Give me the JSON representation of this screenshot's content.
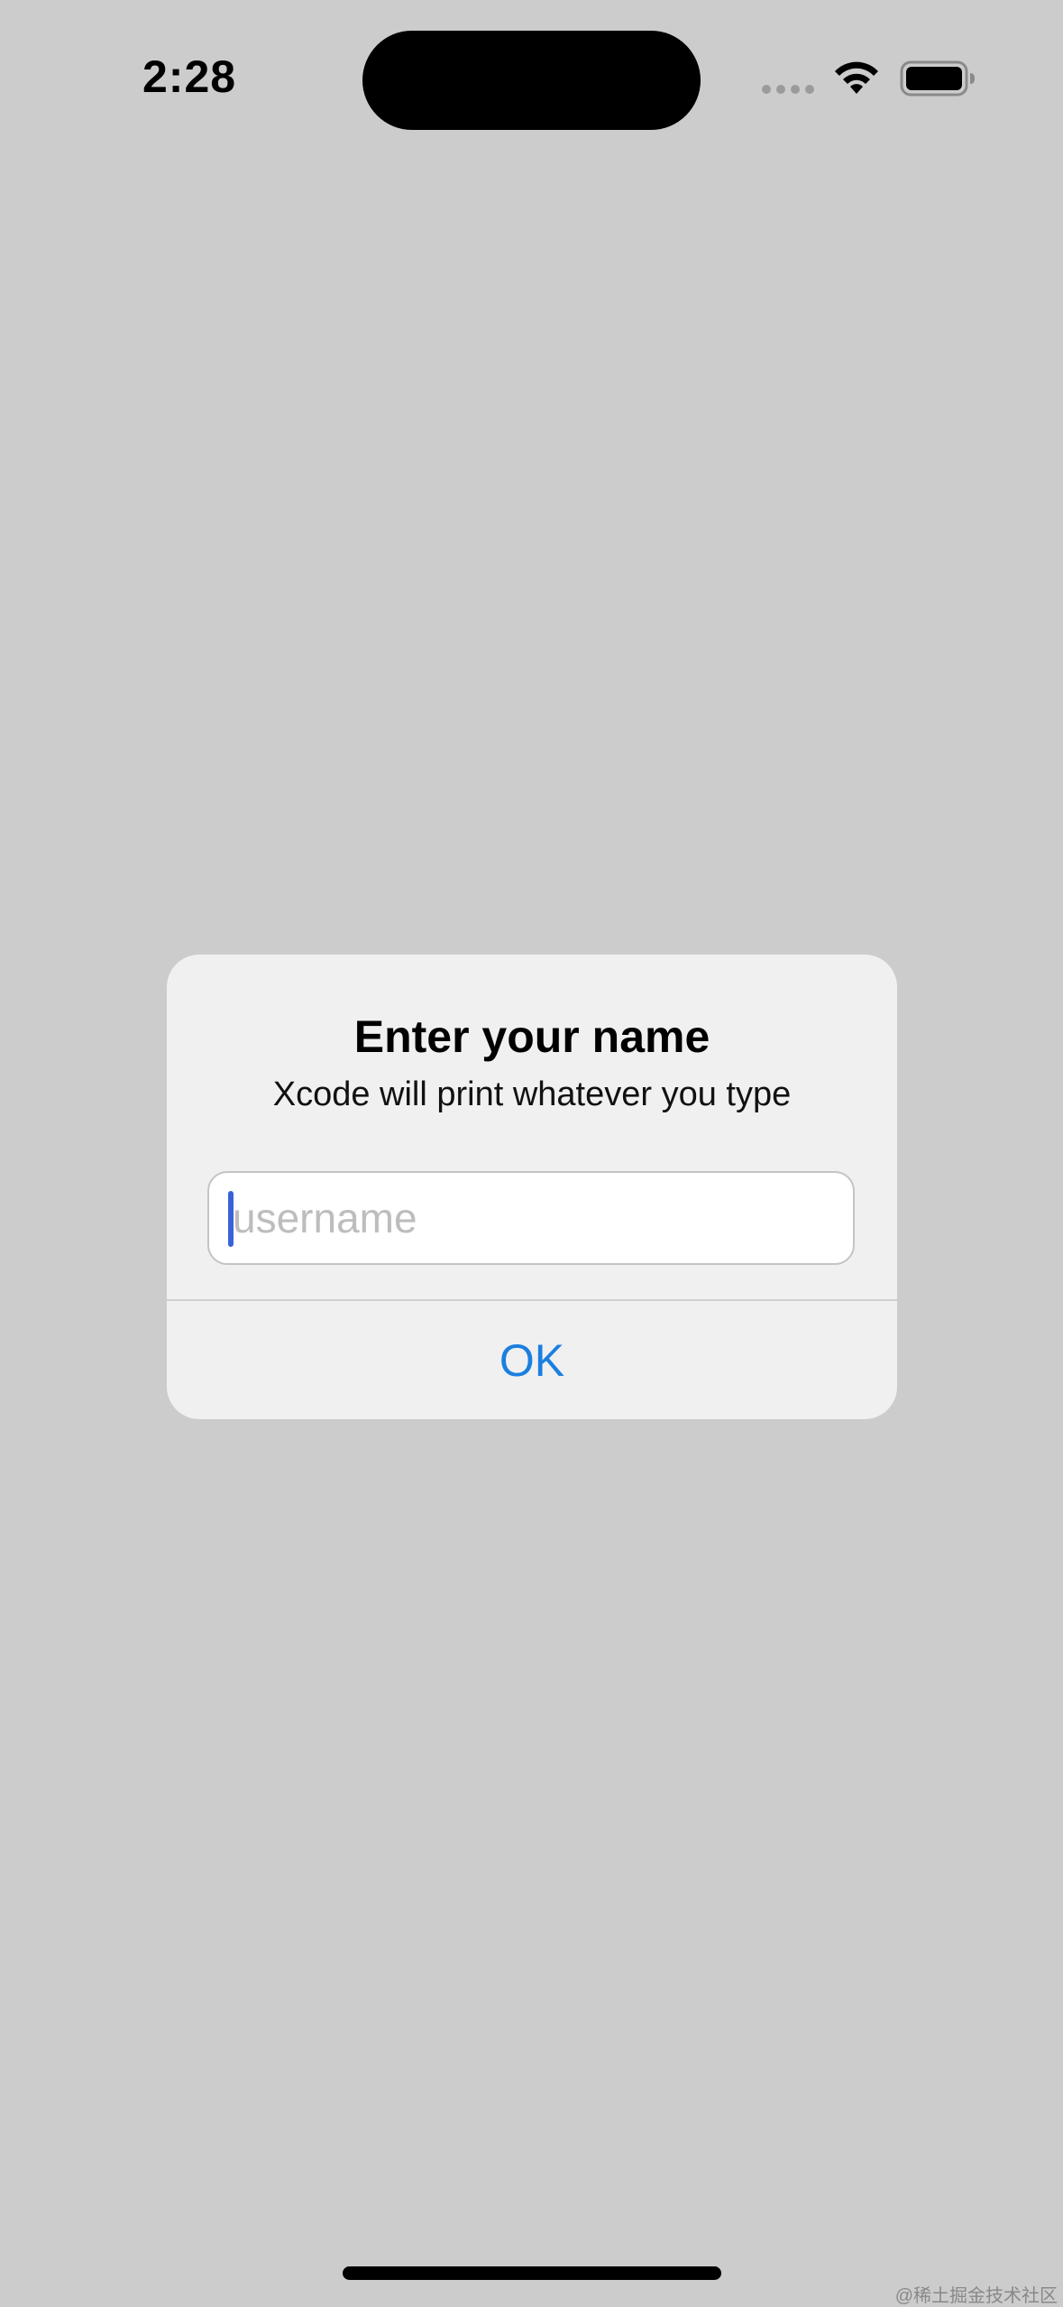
{
  "status_bar": {
    "time": "2:28",
    "icons": [
      "signal-dots-icon",
      "wifi-icon",
      "battery-icon"
    ]
  },
  "alert": {
    "title": "Enter your name",
    "message": "Xcode will print whatever you type",
    "input": {
      "value": "",
      "placeholder": "username"
    },
    "ok_label": "OK"
  },
  "colors": {
    "background": "#cccccc",
    "alert_background": "#f0f0f0",
    "accent": "#1a7fe0",
    "caret": "#3a62d8"
  },
  "watermark": "@稀土掘金技术社区"
}
